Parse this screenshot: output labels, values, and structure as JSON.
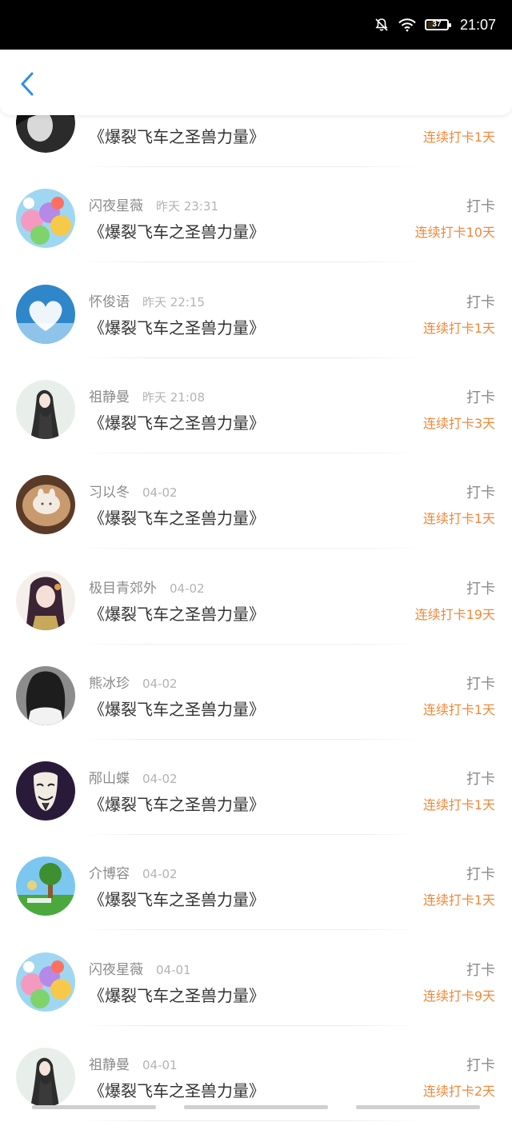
{
  "status_bar": {
    "time": "21:07",
    "battery": "37",
    "battery_level": 0.37
  },
  "header": {
    "back_icon": "chevron-left-icon",
    "accent_color": "#2f8fe0"
  },
  "colors": {
    "streak": "#f0883a",
    "name": "#8a8a8a",
    "book": "#333333"
  },
  "entries": [
    {
      "name": "",
      "time": "",
      "book": "《爆裂飞车之圣兽力量》",
      "action": "",
      "streak": "连续打卡1天",
      "avatar": "partial"
    },
    {
      "name": "闪夜星薇",
      "time": "昨天 23:31",
      "book": "《爆裂飞车之圣兽力量》",
      "action": "打卡",
      "streak": "连续打卡10天",
      "avatar": "cartoon-ponies"
    },
    {
      "name": "怀俊语",
      "time": "昨天 22:15",
      "book": "《爆裂飞车之圣兽力量》",
      "action": "打卡",
      "streak": "连续打卡1天",
      "avatar": "heart-cloud"
    },
    {
      "name": "祖静曼",
      "time": "昨天 21:08",
      "book": "《爆裂飞车之圣兽力量》",
      "action": "打卡",
      "streak": "连续打卡3天",
      "avatar": "girl-sketch"
    },
    {
      "name": "习以冬",
      "time": "04-02",
      "book": "《爆裂飞车之圣兽力量》",
      "action": "打卡",
      "streak": "连续打卡1天",
      "avatar": "latte-art"
    },
    {
      "name": "极目青郊外",
      "time": "04-02",
      "book": "《爆裂飞车之圣兽力量》",
      "action": "打卡",
      "streak": "连续打卡19天",
      "avatar": "anime-girl"
    },
    {
      "name": "熊冰珍",
      "time": "04-02",
      "book": "《爆裂飞车之圣兽力量》",
      "action": "打卡",
      "streak": "连续打卡1天",
      "avatar": "bw-portrait"
    },
    {
      "name": "邴山蝶",
      "time": "04-02",
      "book": "《爆裂飞车之圣兽力量》",
      "action": "打卡",
      "streak": "连续打卡1天",
      "avatar": "mask"
    },
    {
      "name": "介博容",
      "time": "04-02",
      "book": "《爆裂飞车之圣兽力量》",
      "action": "打卡",
      "streak": "连续打卡1天",
      "avatar": "tree-landscape"
    },
    {
      "name": "闪夜星薇",
      "time": "04-01",
      "book": "《爆裂飞车之圣兽力量》",
      "action": "打卡",
      "streak": "连续打卡9天",
      "avatar": "cartoon-ponies"
    },
    {
      "name": "祖静曼",
      "time": "04-01",
      "book": "《爆裂飞车之圣兽力量》",
      "action": "打卡",
      "streak": "连续打卡2天",
      "avatar": "girl-sketch"
    }
  ]
}
